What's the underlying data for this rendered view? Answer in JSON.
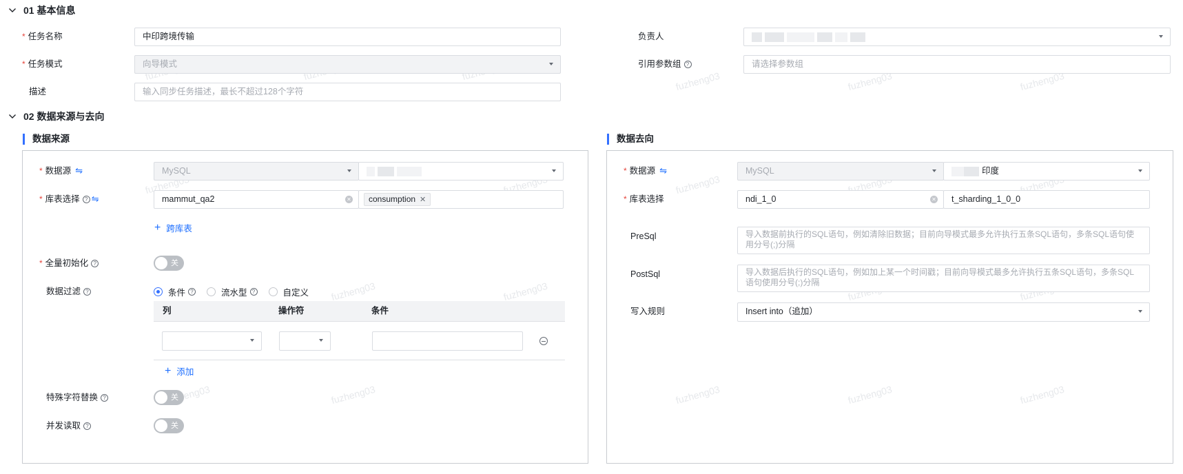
{
  "section1": {
    "title": "01 基本信息",
    "task_name_label": "任务名称",
    "task_name_value": "中印跨境传输",
    "owner_label": "负责人",
    "task_mode_label": "任务模式",
    "task_mode_value": "向导模式",
    "param_group_label": "引用参数组",
    "param_group_placeholder": "请选择参数组",
    "desc_label": "描述",
    "desc_placeholder": "输入同步任务描述，最长不超过128个字符"
  },
  "section2": {
    "title": "02 数据来源与去向",
    "source": {
      "title": "数据来源",
      "datasource_label": "数据源",
      "datasource_type": "MySQL",
      "table_label": "库表选择",
      "db_value": "mammut_qa2",
      "table_tag": "consumption",
      "cross_db_link": "跨库表",
      "full_init_label": "全量初始化",
      "full_init_state": "关",
      "filter_label": "数据过滤",
      "filter_options": [
        "条件",
        "流水型",
        "自定义"
      ],
      "filter_columns": [
        "列",
        "操作符",
        "条件"
      ],
      "add_link": "添加",
      "special_char_label": "特殊字符替换",
      "special_char_state": "关",
      "concurrent_label": "并发读取",
      "concurrent_state": "关"
    },
    "dest": {
      "title": "数据去向",
      "datasource_label": "数据源",
      "datasource_type": "MySQL",
      "datasource_name": "印度",
      "table_label": "库表选择",
      "db_value": "ndi_1_0",
      "table_value": "t_sharding_1_0_0",
      "presql_label": "PreSql",
      "presql_placeholder_1": "导入数据前执行的SQL语句，例如清除旧数据；目前向导模式最多允许执行五条SQL语句，多条SQL语句使",
      "presql_placeholder_2": "用分号(;)分隔",
      "postsql_label": "PostSql",
      "postsql_placeholder_1": "导入数据后执行的SQL语句，例如加上某一个时间戳；目前向导模式最多允许执行五条SQL语句，多条SQL",
      "postsql_placeholder_2": "语句使用分号(;)分隔",
      "write_rule_label": "写入规则",
      "write_rule_value": "Insert into（追加）"
    }
  },
  "watermark_text": "fuzheng03",
  "colors": {
    "accent": "#3370ff",
    "required": "#e5443b",
    "link": "#1e6fff"
  }
}
